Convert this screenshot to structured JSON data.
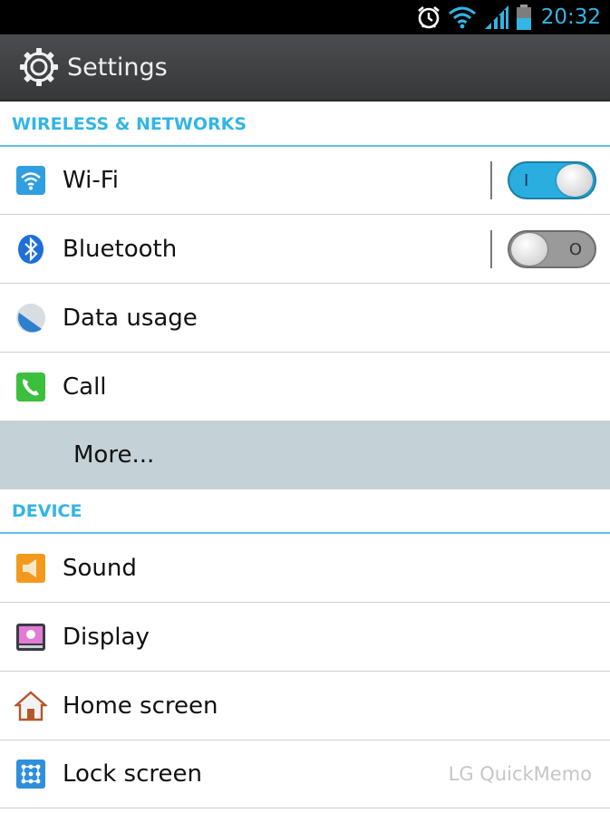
{
  "status_bar": {
    "time": "20:32",
    "icons": [
      "alarm-icon",
      "wifi-signal-icon",
      "cell-signal-icon",
      "battery-icon"
    ],
    "accent_color": "#33b5e5"
  },
  "action_bar": {
    "title": "Settings",
    "icon": "gear-icon"
  },
  "sections": [
    {
      "header": "WIRELESS & NETWORKS",
      "items": [
        {
          "label": "Wi-Fi",
          "icon": "wifi-icon",
          "toggle": "on",
          "toggle_mark": "I"
        },
        {
          "label": "Bluetooth",
          "icon": "bluetooth-icon",
          "toggle": "off",
          "toggle_mark": "O"
        },
        {
          "label": "Data usage",
          "icon": "data-usage-icon"
        },
        {
          "label": "Call",
          "icon": "phone-icon"
        },
        {
          "label": "More...",
          "highlighted": true
        }
      ]
    },
    {
      "header": "DEVICE",
      "items": [
        {
          "label": "Sound",
          "icon": "sound-icon"
        },
        {
          "label": "Display",
          "icon": "display-icon"
        },
        {
          "label": "Home screen",
          "icon": "home-icon"
        },
        {
          "label": "Lock screen",
          "icon": "lock-screen-icon"
        }
      ]
    }
  ],
  "watermark": "LG QuickMemo"
}
